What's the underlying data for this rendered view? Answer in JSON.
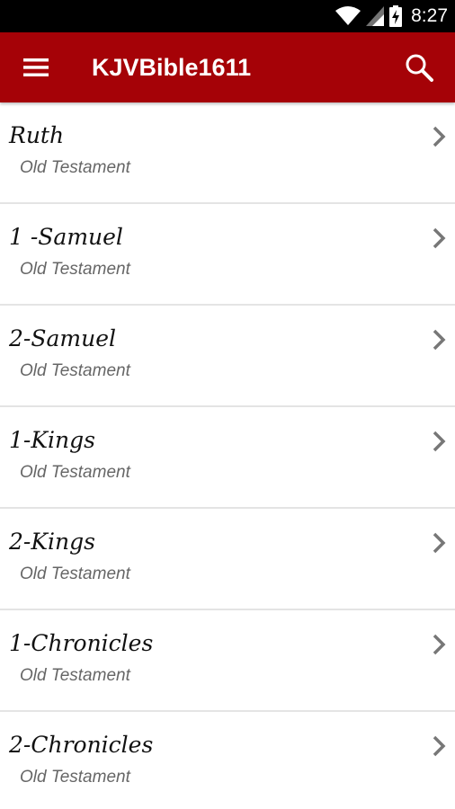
{
  "status_bar": {
    "time": "8:27",
    "icons": [
      "wifi-icon",
      "cell-signal-icon",
      "battery-charging-icon"
    ]
  },
  "app_bar": {
    "title": "KJVBible1611",
    "menu_icon": "hamburger-menu-icon",
    "search_icon": "search-icon",
    "color": "#a50207"
  },
  "books": [
    {
      "name": "Ruth",
      "testament": "Old Testament"
    },
    {
      "name": "1 -Samuel",
      "testament": "Old Testament"
    },
    {
      "name": "2-Samuel",
      "testament": "Old Testament"
    },
    {
      "name": "1-Kings",
      "testament": "Old Testament"
    },
    {
      "name": "2-Kings",
      "testament": "Old Testament"
    },
    {
      "name": "1-Chronicles",
      "testament": "Old Testament"
    },
    {
      "name": "2-Chronicles",
      "testament": "Old Testament"
    }
  ]
}
